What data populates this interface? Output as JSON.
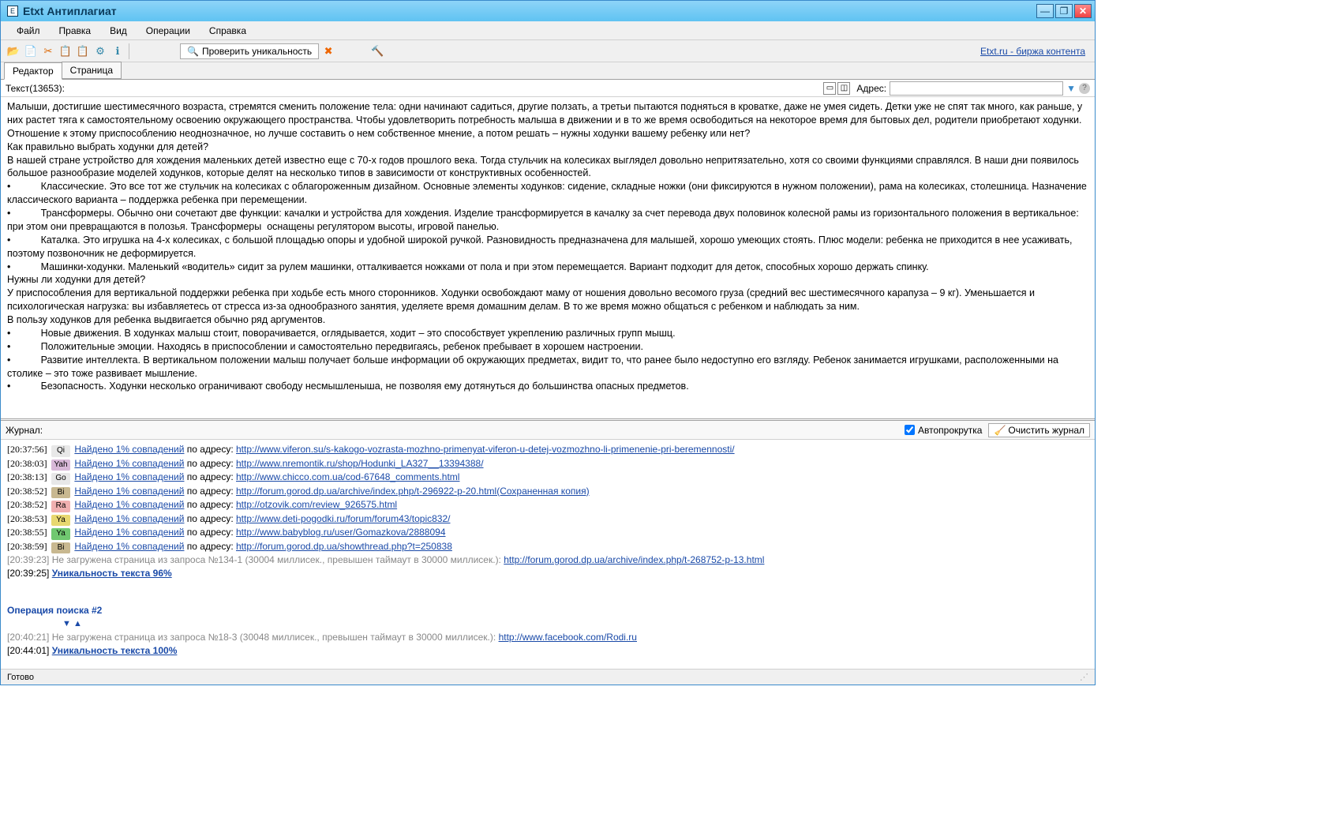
{
  "titlebar": {
    "icon_text": "E",
    "title": "Etxt Антиплагиат"
  },
  "menu": {
    "file": "Файл",
    "edit": "Правка",
    "view": "Вид",
    "ops": "Операции",
    "help": "Справка"
  },
  "toolbar": {
    "check_label": "Проверить уникальность",
    "link_right": "Etxt.ru - биржа контента"
  },
  "tabs": {
    "editor": "Редактор",
    "page": "Страница"
  },
  "infobar": {
    "text_label": "Текст(13653):",
    "addr_label": "Адрес:"
  },
  "document_text": "Малыши, достигшие шестимесячного возраста, стремятся сменить положение тела: одни начинают садиться, другие ползать, а третьи пытаются подняться в кроватке, даже не умея сидеть. Детки уже не спят так много, как раньше, у них растет тяга к самостоятельному освоению окружающего пространства. Чтобы удовлетворить потребность малыша в движении и в то же время освободиться на некоторое время для бытовых дел, родители приобретают ходунки. Отношение к этому приспособлению неоднозначное, но лучше составить о нем собственное мнение, а потом решать – нужны ходунки вашему ребенку или нет?\nКак правильно выбрать ходунки для детей?\nВ нашей стране устройство для хождения маленьких детей известно еще с 70-х годов прошлого века. Тогда стульчик на колесиках выглядел довольно непритязательно, хотя со своими функциями справлялся. В наши дни появилось большое разнообразие моделей ходунков, которые делят на несколько типов в зависимости от конструктивных особенностей.\n•           Классические. Это все тот же стульчик на колесиках с облагороженным дизайном. Основные элементы ходунков: сидение, складные ножки (они фиксируются в нужном положении), рама на колесиках, столешница. Назначение классического варианта – поддержка ребенка при перемещении.\n•           Трансформеры. Обычно они сочетают две функции: качалки и устройства для хождения. Изделие трансформируется в качалку за счет перевода двух половинок колесной рамы из горизонтального положения в вертикальное: при этом они превращаются в полозья. Трансформеры  оснащены регулятором высоты, игровой панелью.\n•           Каталка. Это игрушка на 4-х колесиках, с большой площадью опоры и удобной широкой ручкой. Разновидность предназначена для малышей, хорошо умеющих стоять. Плюс модели: ребенка не приходится в нее усаживать, поэтому позвоночник не деформируется.\n•           Машинки-ходунки. Маленький «водитель» сидит за рулем машинки, отталкивается ножками от пола и при этом перемещается. Вариант подходит для деток, способных хорошо держать спинку.\nНужны ли ходунки для детей?\nУ приспособления для вертикальной поддержки ребенка при ходьбе есть много сторонников. Ходунки освобождают маму от ношения довольно весомого груза (средний вес шестимесячного карапуза – 9 кг). Уменьшается и психологическая нагрузка: вы избавляетесь от стресса из-за однообразного занятия, уделяете время домашним делам. В то же время можно общаться с ребенком и наблюдать за ним.\nВ пользу ходунков для ребенка выдвигается обычно ряд аргументов.\n•           Новые движения. В ходунках малыш стоит, поворачивается, оглядывается, ходит – это способствует укреплению различных групп мышц.\n•           Положительные эмоции. Находясь в приспособлении и самостоятельно передвигаясь, ребенок пребывает в хорошем настроении.\n•           Развитие интеллекта. В вертикальном положении малыш получает больше информации об окружающих предметах, видит то, что ранее было недоступно его взгляду. Ребенок занимается игрушками, расположенными на столике – это тоже развивает мышление.\n•           Безопасность. Ходунки несколько ограничивают свободу несмышленыша, не позволяя ему дотянуться до большинства опасных предметов.",
  "log": {
    "header": "Журнал:",
    "autoscroll": "Автопрокрутка",
    "clear": "Очистить журнал",
    "match_prefix": "Найдено 1% совпадений",
    "by_addr": " по адресу: ",
    "entries": [
      {
        "ts": "[20:37:56]",
        "se": "Qi",
        "se_bg": "#e8e8e8",
        "url": "http://www.viferon.su/s-kakogo-vozrasta-mozhno-primenyat-viferon-u-detej-vozmozhno-li-primenenie-pri-beremennosti/"
      },
      {
        "ts": "[20:38:03]",
        "se": "Yah",
        "se_bg": "#d8b8d8",
        "url": "http://www.nremontik.ru/shop/Hodunki_LA327__13394388/"
      },
      {
        "ts": "[20:38:13]",
        "se": "Go",
        "se_bg": "#e8e8e8",
        "url": "http://www.chicco.com.ua/cod-67648_comments.html"
      },
      {
        "ts": "[20:38:52]",
        "se": "Bi",
        "se_bg": "#c8b890",
        "url": "http://forum.gorod.dp.ua/archive/index.php/t-296922-p-20.html(Сохраненная копия)"
      },
      {
        "ts": "[20:38:52]",
        "se": "Ra",
        "se_bg": "#f0b0b0",
        "url": "http://otzovik.com/review_926575.html"
      },
      {
        "ts": "[20:38:53]",
        "se": "Ya",
        "se_bg": "#e8d870",
        "url": "http://www.deti-pogodki.ru/forum/forum43/topic832/"
      },
      {
        "ts": "[20:38:55]",
        "se": "Ya",
        "se_bg": "#70c870",
        "url": "http://www.babyblog.ru/user/Gomazkova/2888094"
      },
      {
        "ts": "[20:38:59]",
        "se": "Bi",
        "se_bg": "#c8b890",
        "url": "http://forum.gorod.dp.ua/showthread.php?t=250838"
      }
    ],
    "timeout1_ts": "[20:39:23]",
    "timeout1_text": "     Не загружена страница из запроса №134-1 (30004 миллисек., превышен таймаут в 30000 миллисек.): ",
    "timeout1_url": "http://forum.gorod.dp.ua/archive/index.php/t-268752-p-13.html",
    "result1_ts": "[20:39:25] ",
    "result1_text": "Уникальность текста 96%",
    "op2_header": "Операция поиска #2",
    "op2_arrows": "▼    ▲",
    "timeout2_ts": "[20:40:21]",
    "timeout2_text": "     Не загружена страница из запроса №18-3 (30048 миллисек., превышен таймаут в 30000 миллисек.): ",
    "timeout2_url": "http://www.facebook.com/Rodi.ru",
    "result2_ts": "[20:44:01] ",
    "result2_text": "Уникальность текста 100%"
  },
  "status": {
    "text": "Готово"
  }
}
